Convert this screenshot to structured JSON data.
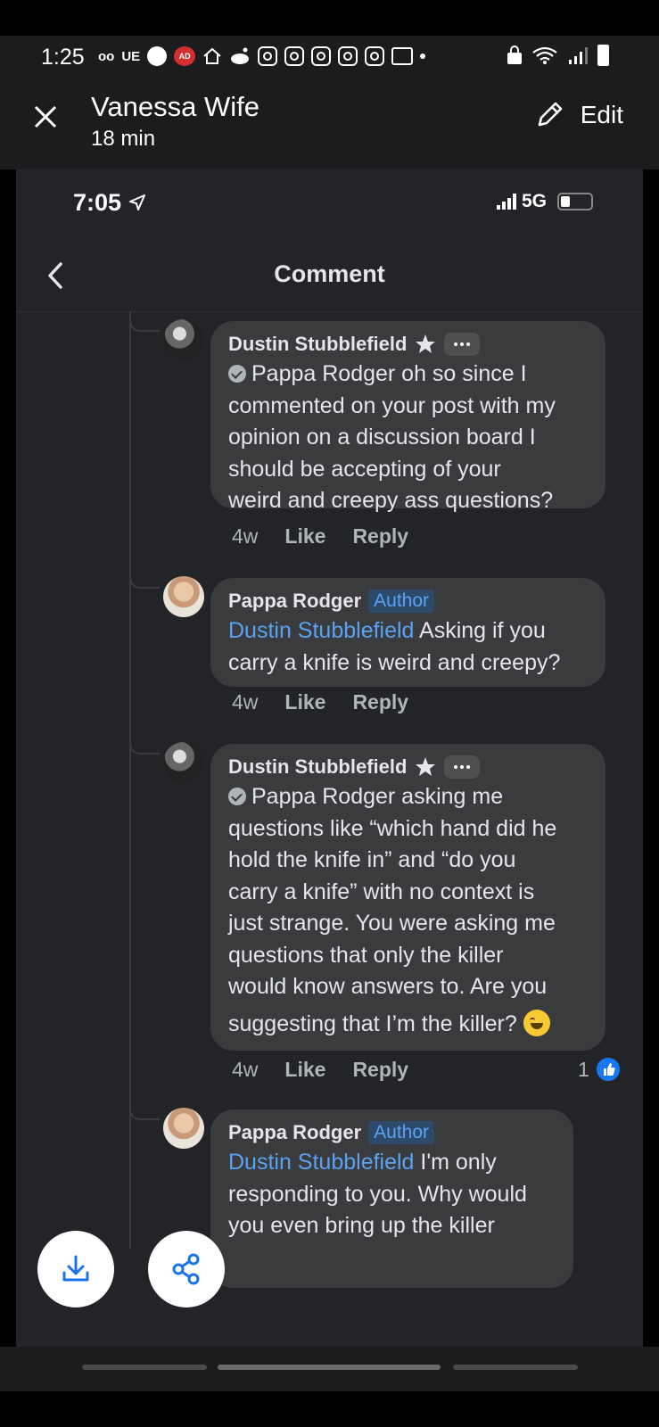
{
  "status_bar": {
    "time": "1:25",
    "left_glyphs": [
      "voicemail-icon",
      "UE",
      "messenger-icon",
      "ad-blocker-icon",
      "home-icon",
      "reddit-icon",
      "instagram-icon",
      "instagram-icon",
      "instagram-icon",
      "instagram-icon",
      "instagram-icon",
      "mail-icon",
      "dot"
    ],
    "ue_label": "UE",
    "voicemail_label": "ᴏᴏ",
    "ad_label": "AD",
    "right_glyphs": [
      "vpn-lock-icon",
      "wifi-icon",
      "signal-icon",
      "battery-icon"
    ]
  },
  "viewer": {
    "title": "Vanessa Wife",
    "subtitle": "18 min",
    "edit_label": "Edit"
  },
  "inner_status": {
    "time": "7:05",
    "network": "5G"
  },
  "page": {
    "title": "Comment"
  },
  "comments": [
    {
      "author": "Dustin Stubblefield",
      "badge": "star",
      "text": "Pappa Rodger oh so since I commented on your post with my opinion on a discussion board I should be accepting of your weird and creepy ass questions?",
      "lines": [
        "Pappa Rodger oh so since I",
        "commented on your post with my",
        "opinion on a discussion board I",
        "should be accepting of your",
        "weird and creepy ass questions?"
      ],
      "time": "4w",
      "like": "Like",
      "reply": "Reply"
    },
    {
      "author": "Pappa Rodger",
      "badge_label": "Author",
      "mention": "Dustin Stubblefield",
      "line1_rest": " Asking if you",
      "line2": "carry a knife is weird and creepy?",
      "time": "4w",
      "like": "Like",
      "reply": "Reply"
    },
    {
      "author": "Dustin Stubblefield",
      "badge": "star",
      "lines": [
        "Pappa Rodger asking me",
        "questions like “which hand did he",
        "hold the knife in” and “do you",
        "carry a knife” with no context is",
        "just strange. You were asking me",
        "questions that only the killer",
        "would know answers to. Are you",
        "suggesting that I’m the killer?"
      ],
      "time": "4w",
      "like": "Like",
      "reply": "Reply",
      "like_count": "1"
    },
    {
      "author": "Pappa Rodger",
      "badge_label": "Author",
      "mention": "Dustin Stubblefield",
      "line1_rest": " I'm only",
      "line2": "responding to you. Why would",
      "line3": "you even bring up the killer"
    }
  ],
  "colors": {
    "background": "#232427",
    "bubble": "#3a3b3c",
    "mention": "#5aa2f2",
    "like_blue": "#1877f2",
    "secondary_text": "#b0b3b8"
  }
}
